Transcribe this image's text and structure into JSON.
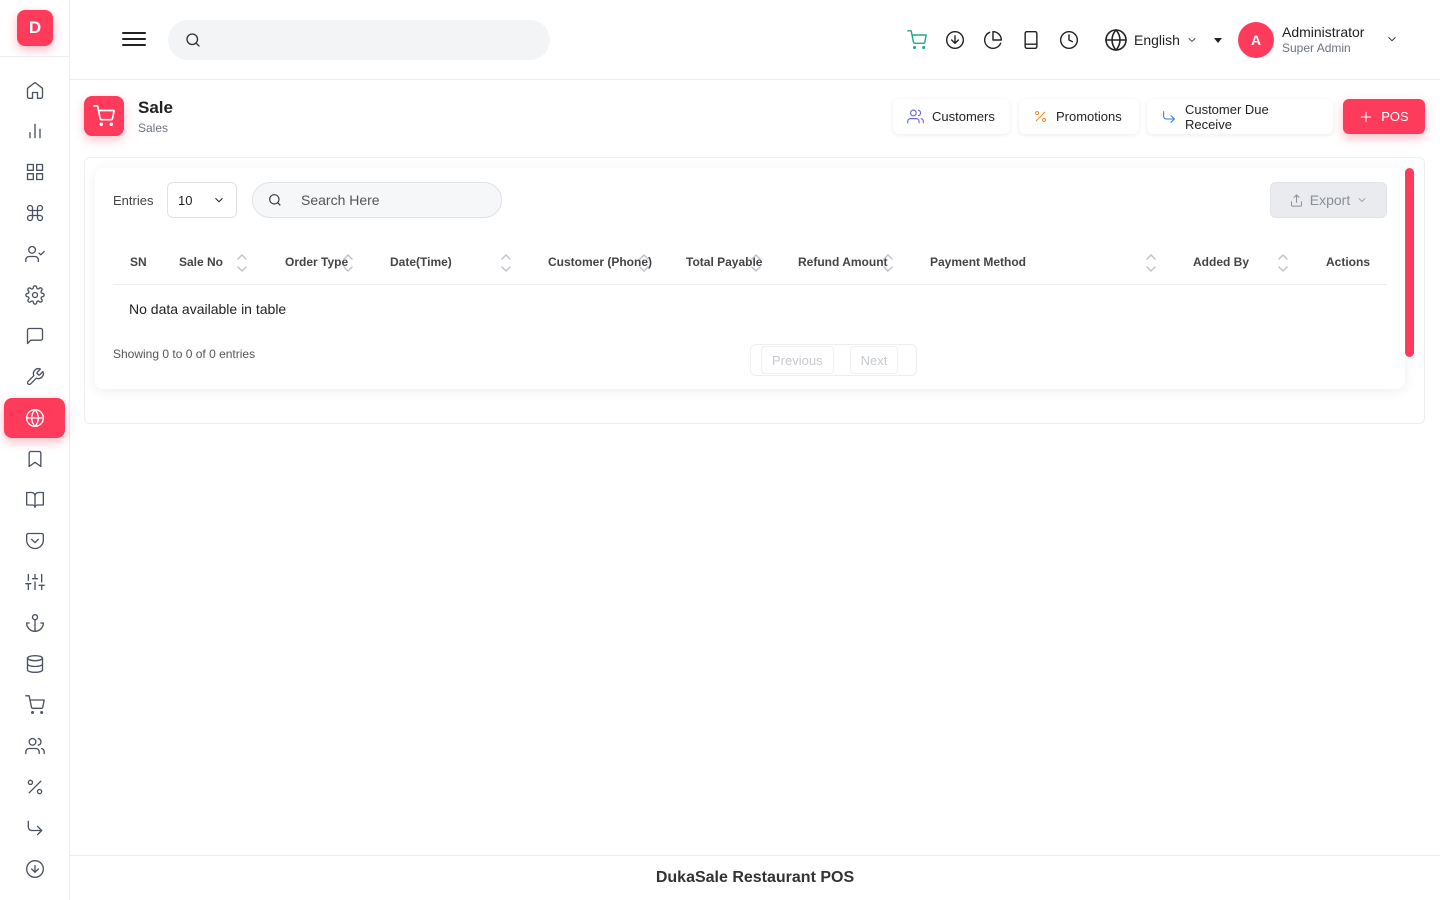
{
  "app": {
    "logo_letter": "D",
    "brand_color": "#ff3b5c",
    "footer": "DukaSale Restaurant POS"
  },
  "sidebar": {
    "items": [
      {
        "name": "home-icon"
      },
      {
        "name": "bar-chart-icon"
      },
      {
        "name": "grid-icon"
      },
      {
        "name": "command-icon"
      },
      {
        "name": "user-check-icon"
      },
      {
        "name": "settings-icon"
      },
      {
        "name": "message-icon"
      },
      {
        "name": "tool-icon"
      },
      {
        "name": "globe-icon",
        "active": true
      },
      {
        "name": "bookmark-icon"
      },
      {
        "name": "book-open-icon"
      },
      {
        "name": "pocket-icon"
      },
      {
        "name": "sliders-icon"
      },
      {
        "name": "anchor-icon"
      },
      {
        "name": "database-icon"
      },
      {
        "name": "cart-icon"
      },
      {
        "name": "users-icon"
      },
      {
        "name": "percent-icon"
      },
      {
        "name": "corner-down-right-icon"
      },
      {
        "name": "arrow-down-circle-icon"
      }
    ]
  },
  "topbar": {
    "search": {
      "value": "",
      "placeholder": ""
    },
    "icons": [
      "cart-icon",
      "download-circle-icon",
      "pie-chart-icon",
      "tablet-icon",
      "clock-icon"
    ],
    "language": "English",
    "user": {
      "avatar_letter": "A",
      "name": "Administrator",
      "role": "Super Admin"
    }
  },
  "page": {
    "title": "Sale",
    "subtitle": "Sales",
    "actions": {
      "customers": "Customers",
      "promotions": "Promotions",
      "due_receive": "Customer Due Receive",
      "pos": "POS"
    }
  },
  "table": {
    "entries_label": "Entries",
    "entries_value": "10",
    "search_placeholder": "Search Here",
    "export_label": "Export",
    "columns": [
      "SN",
      "Sale No",
      "Order Type",
      "Date(Time)",
      "Customer (Phone)",
      "Total Payable",
      "Refund Amount",
      "Payment Method",
      "Added By",
      "Actions"
    ],
    "empty_message": "No data available in table",
    "info": "Showing 0 to 0 of 0 entries",
    "pagination": {
      "previous": "Previous",
      "next": "Next"
    }
  }
}
